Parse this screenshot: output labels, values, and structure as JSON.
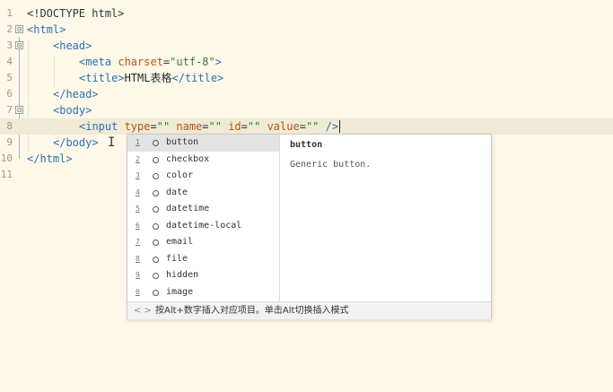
{
  "editor": {
    "line_numbers": [
      "1",
      "2",
      "3",
      "4",
      "5",
      "6",
      "7",
      "8",
      "9",
      "10",
      "11"
    ],
    "fold_symbols": [
      "⊟",
      "⊟",
      "⊟"
    ],
    "code": {
      "l1": "<!DOCTYPE html>",
      "l2_tag": "<html>",
      "l3_tag": "<head>",
      "l4_open": "<meta",
      "l4_attr": " charset",
      "l4_eq": "=",
      "l4_val": "\"utf-8\"",
      "l4_close": ">",
      "l5_open": "<title>",
      "l5_text": "HTML表格",
      "l5_close": "</title>",
      "l6_tag": "</head>",
      "l7_tag": "<body>",
      "l8_open": "<input",
      "l8_attr1": " type",
      "l8_eq1": "=",
      "l8_val1": "\"\"",
      "l8_attr2": " name",
      "l8_eq2": "=",
      "l8_val2": "\"\"",
      "l8_attr3": " id",
      "l8_eq3": "=",
      "l8_val3": "\"\"",
      "l8_attr4": " value",
      "l8_eq4": "=",
      "l8_val4": "\"\"",
      "l8_close": " />",
      "l9_tag": "</body>",
      "l10_tag": "</html>"
    },
    "ibeam_glyph": "I"
  },
  "autocomplete": {
    "items": [
      {
        "index": "1",
        "label": "button"
      },
      {
        "index": "2",
        "label": "checkbox"
      },
      {
        "index": "3",
        "label": "color"
      },
      {
        "index": "4",
        "label": "date"
      },
      {
        "index": "5",
        "label": "datetime"
      },
      {
        "index": "6",
        "label": "datetime-local"
      },
      {
        "index": "7",
        "label": "email"
      },
      {
        "index": "8",
        "label": "file"
      },
      {
        "index": "9",
        "label": "hidden"
      },
      {
        "index": "0",
        "label": "image"
      }
    ],
    "selected_index": 0,
    "detail_title": "button",
    "detail_description": "Generic button.",
    "footer_nav": "< >",
    "footer_hint": "按Alt+数字插入对应项目。单击Alt切换插入模式"
  }
}
